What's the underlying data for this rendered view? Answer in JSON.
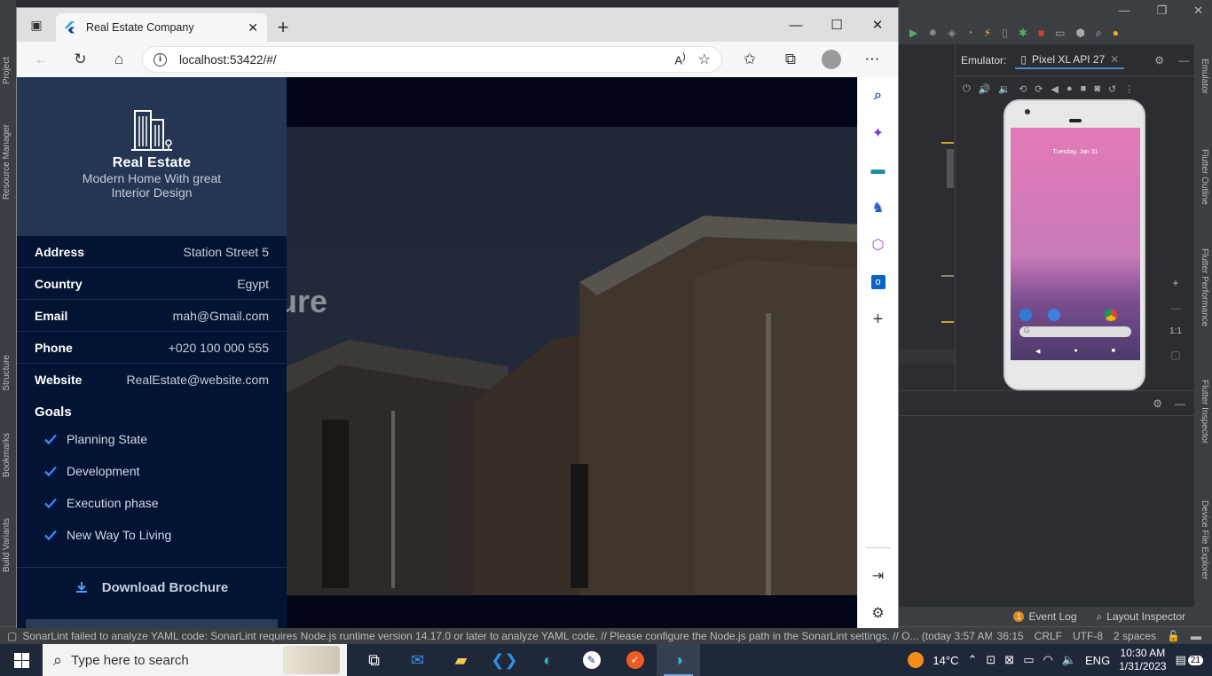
{
  "browser": {
    "tab_title": "Real Estate Company",
    "url": "localhost:53422/#/"
  },
  "drawer": {
    "title": "Real Estate",
    "subtitle": "Modern Home With great Interior Design",
    "info": [
      {
        "label": "Address",
        "value": "Station Street 5"
      },
      {
        "label": "Country",
        "value": "Egypt"
      },
      {
        "label": "Email",
        "value": "mah@Gmail.com"
      },
      {
        "label": "Phone",
        "value": "+020 100 000 555"
      },
      {
        "label": "Website",
        "value": "RealEstate@website.com"
      }
    ],
    "goals_title": "Goals",
    "goals": [
      "Planning State",
      "Development",
      "Execution phase",
      "New Way To Living"
    ],
    "download_label": "Download Brochure"
  },
  "hero": {
    "heading_fragment": "ure"
  },
  "ide": {
    "emulator_label": "Emulator:",
    "device_tab": "Pixel XL API 27",
    "phone_date": "Tuesday, Jan 31",
    "zoom_label": "1:1",
    "left_tools": [
      "Project",
      "Resource Manager",
      "Structure",
      "Bookmarks",
      "Build Variants"
    ],
    "right_tools": [
      "Emulator",
      "Flutter Outline",
      "Flutter Performance",
      "Flutter Inspector",
      "Device File Explorer"
    ],
    "event_log": "Event Log",
    "layout_inspector": "Layout Inspector",
    "status_message": "SonarLint failed to analyze YAML code: SonarLint requires Node.js runtime version 14.17.0 or later to analyze YAML code. // Please configure the Node.js path in the SonarLint settings. // O... (today 3:57 AM)",
    "status_position": "36:15",
    "status_eol": "CRLF",
    "status_encoding": "UTF-8",
    "status_indent": "2 spaces"
  },
  "taskbar": {
    "search_placeholder": "Type here to search",
    "temperature": "14°C",
    "language": "ENG",
    "time": "10:30 AM",
    "date": "1/31/2023",
    "notifications": "21"
  },
  "colors": {
    "drawer_bg": "#021333",
    "drawer_header_bg": "#253654",
    "check_blue": "#3b82f6"
  }
}
